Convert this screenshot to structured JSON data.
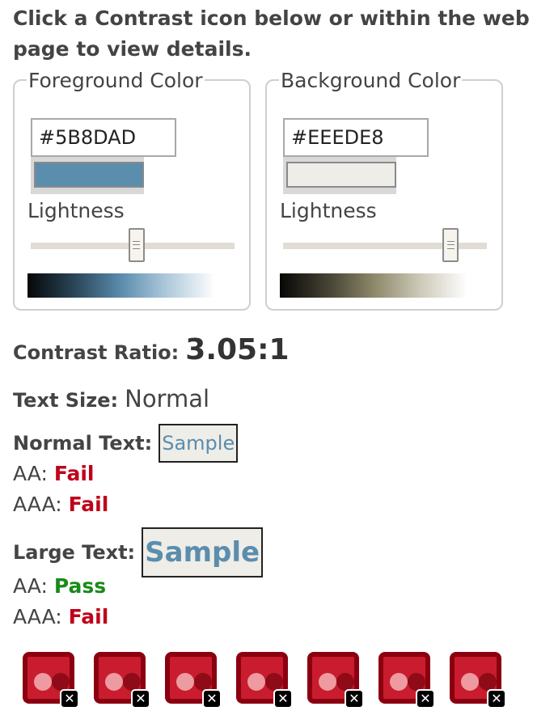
{
  "intro": "Click a Contrast icon below or within the web page to view details.",
  "foreground": {
    "legend": "Foreground Color",
    "hex": "#5B8DAD",
    "swatch_color": "#5B8DAD",
    "lightness_label": "Lightness",
    "lightness_value": 0.52
  },
  "background": {
    "legend": "Background Color",
    "hex": "#EEEDE8",
    "swatch_color": "#EEEDE8",
    "lightness_label": "Lightness",
    "lightness_value": 0.85
  },
  "contrast": {
    "label": "Contrast Ratio:",
    "value": "3.05:1"
  },
  "text_size": {
    "label": "Text Size:",
    "value": "Normal"
  },
  "normal_text": {
    "label": "Normal Text:",
    "sample": "Sample",
    "aa_label": "AA:",
    "aa_result": "Fail",
    "aaa_label": "AAA:",
    "aaa_result": "Fail"
  },
  "large_text": {
    "label": "Large Text:",
    "sample": "Sample",
    "aa_label": "AA:",
    "aa_result": "Pass",
    "aaa_label": "AAA:",
    "aaa_result": "Fail"
  },
  "icons": [
    {
      "name": "contrast-icon",
      "badge": "✕"
    },
    {
      "name": "contrast-icon",
      "badge": "✕"
    },
    {
      "name": "contrast-icon",
      "badge": "✕"
    },
    {
      "name": "contrast-icon",
      "badge": "✕"
    },
    {
      "name": "contrast-icon",
      "badge": "✕"
    },
    {
      "name": "contrast-icon",
      "badge": "✕"
    },
    {
      "name": "contrast-icon",
      "badge": "✕"
    }
  ],
  "colors": {
    "fail": "#C0001A",
    "pass": "#1A8A1A",
    "icon_red": "#C91C2E"
  }
}
